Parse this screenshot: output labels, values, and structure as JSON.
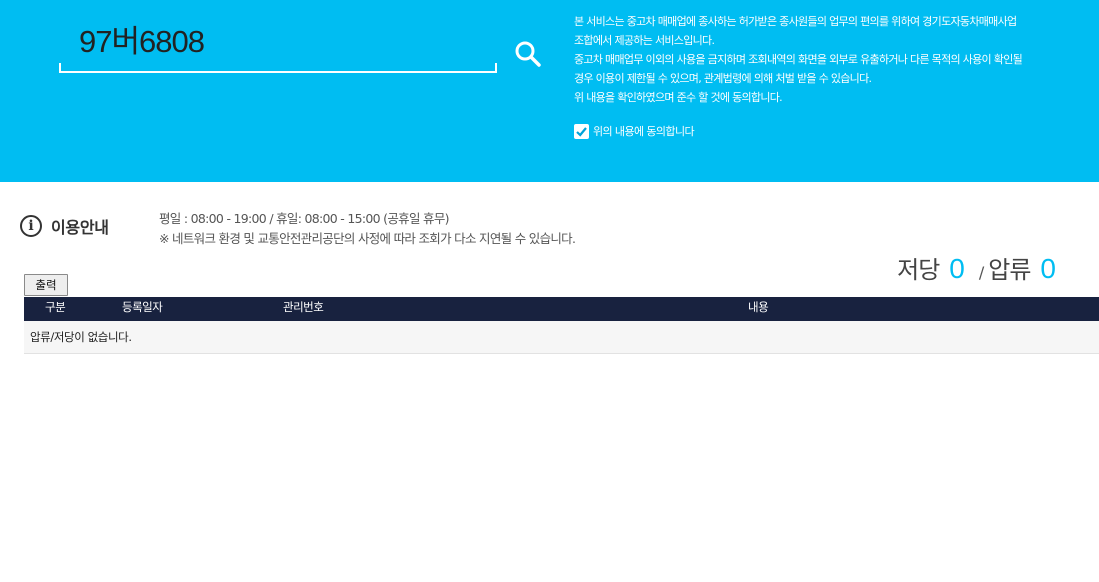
{
  "search": {
    "value": "97버6808"
  },
  "notice": {
    "lines": [
      "본 서비스는 중고차 매매업에 종사하는 허가받은 종사원들의 업무의 편의를 위하여 경기도자동차매매사업",
      "조합에서 제공하는 서비스입니다.",
      "중고차 매매업무 이외의 사용을 금지하며 조회내역의 화면을 외부로 유출하거나 다른 목적의 사용이 확인될",
      "경우 이용이 제한될 수 있으며, 관계법령에 의해 처벌 받을 수 있습니다.",
      "위 내용을 확인하였으며 준수 할 것에 동의합니다."
    ],
    "agree_label": "위의 내용에 동의합니다"
  },
  "info": {
    "title": "이용안내",
    "hours": "평일 : 08:00 - 19:00 / 휴일: 08:00 - 15:00 (공휴일 휴무)",
    "notice": "※ 네트워크 환경 및 교통안전관리공단의 사정에 따라 조회가 다소 지연될 수 있습니다."
  },
  "counts": {
    "seizure_label": "저당",
    "seizure_value": "0",
    "separator": "/",
    "attachment_label": "압류",
    "attachment_value": "0"
  },
  "toolbar": {
    "print_label": "출력"
  },
  "table": {
    "columns": [
      "구분",
      "등록일자",
      "관리번호",
      "내용"
    ],
    "empty_message": "압류/저당이 없습니다."
  },
  "colors": {
    "banner": "#00bdf2",
    "table_header": "#18223f",
    "count_value": "#00bdf2"
  },
  "icons": {
    "search": "search-icon",
    "checkbox": "checkmark-icon",
    "info": "info-circle-icon"
  }
}
